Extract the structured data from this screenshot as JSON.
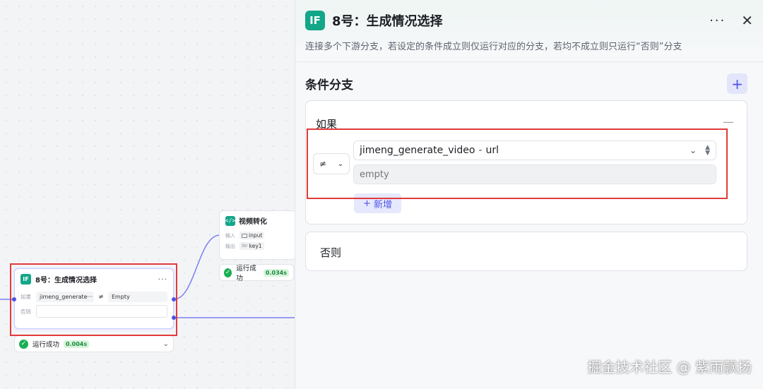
{
  "canvas": {
    "video_node": {
      "title": "视频转化",
      "input_label": "输入",
      "input_value": "input",
      "output_label": "输出",
      "output_value": "key1",
      "status": "运行成功",
      "time": "0.034s"
    },
    "if_node": {
      "title": "8号：生成情况选择",
      "if_label": "如果",
      "variable": "jimeng_generate···",
      "operator_icon": "not-equal-icon",
      "value": "Empty",
      "else_label": "否则",
      "status": "运行成功",
      "time": "0.004s"
    }
  },
  "panel": {
    "badge": "IF",
    "title": "8号：生成情况选择",
    "description": "连接多个下游分支，若设定的条件成立则仅运行对应的分支，若均不成立则只运行“否则”分支",
    "section_title": "条件分支",
    "if_label": "如果",
    "operator_symbol": "≠",
    "variable": "jimeng_generate_video",
    "variable_field": "url",
    "value_placeholder": "empty",
    "new_label": "新增",
    "else_label": "否则"
  },
  "watermark": "掘金技术社区 @ 紫雨飘扬",
  "colors": {
    "accent": "#4d53e8",
    "node_badge": "#13a689",
    "success": "#1aaf54",
    "highlight": "#e23a3a"
  }
}
